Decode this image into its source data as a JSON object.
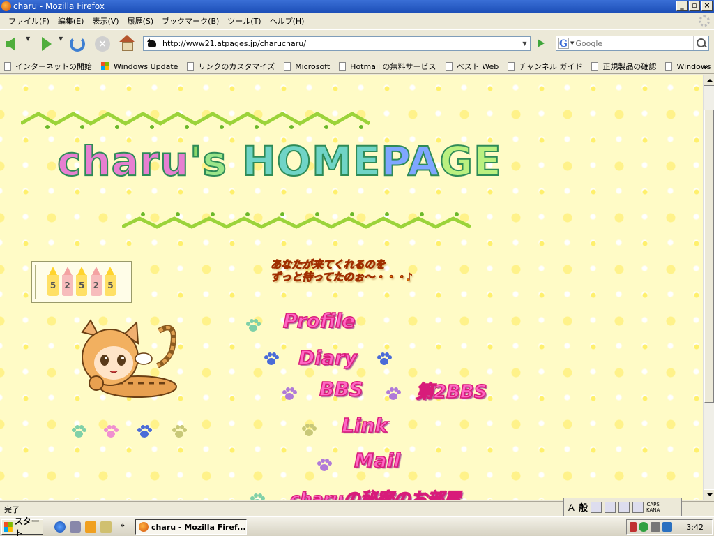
{
  "window": {
    "title": "charu - Mozilla Firefox"
  },
  "menu": [
    "ファイル(F)",
    "編集(E)",
    "表示(V)",
    "履歴(S)",
    "ブックマーク(B)",
    "ツール(T)",
    "ヘルプ(H)"
  ],
  "nav": {
    "url": "http://www21.atpages.jp/charucharu/",
    "search_placeholder": "Google"
  },
  "bookmarks": [
    {
      "label": "インターネットの開始",
      "icon": "doc"
    },
    {
      "label": "Windows Update",
      "icon": "windows"
    },
    {
      "label": "リンクのカスタマイズ",
      "icon": "doc"
    },
    {
      "label": "Microsoft",
      "icon": "doc"
    },
    {
      "label": "Hotmail の無料サービス",
      "icon": "doc"
    },
    {
      "label": "ベスト Web",
      "icon": "doc"
    },
    {
      "label": "チャンネル ガイド",
      "icon": "doc"
    },
    {
      "label": "正規製品の確認",
      "icon": "doc"
    },
    {
      "label": "Windows",
      "icon": "doc"
    }
  ],
  "bookmarks_more": "»",
  "page": {
    "logo_parts": [
      "charu",
      "'",
      "s",
      "HOME",
      "PA",
      "GE"
    ],
    "counter_digits": [
      "5",
      "2",
      "5",
      "2",
      "5"
    ],
    "welcome_line1": "あなたが来てくれるのを",
    "welcome_line2": "ずっと待ってたのぉ〜・・・♪",
    "links": {
      "profile": "Profile",
      "diary": "Diary",
      "bbs": "BBS",
      "bbs2": "第2BBS",
      "link": "Link",
      "mail": "Mail",
      "secret": "charuの秘密のお部屋"
    },
    "paw_colors": {
      "green": "#7fd0a8",
      "pink": "#f08fd0",
      "blue": "#4a6bd8",
      "olive": "#c8c878",
      "purple": "#b07ad8"
    }
  },
  "status": {
    "text": "完了"
  },
  "ime": {
    "mode": "般",
    "caps": "CAPS",
    "kana": "KANA"
  },
  "taskbar": {
    "start": "スタート",
    "task_button": "charu - Mozilla Firef...",
    "clock": "3:42",
    "more": "»"
  }
}
